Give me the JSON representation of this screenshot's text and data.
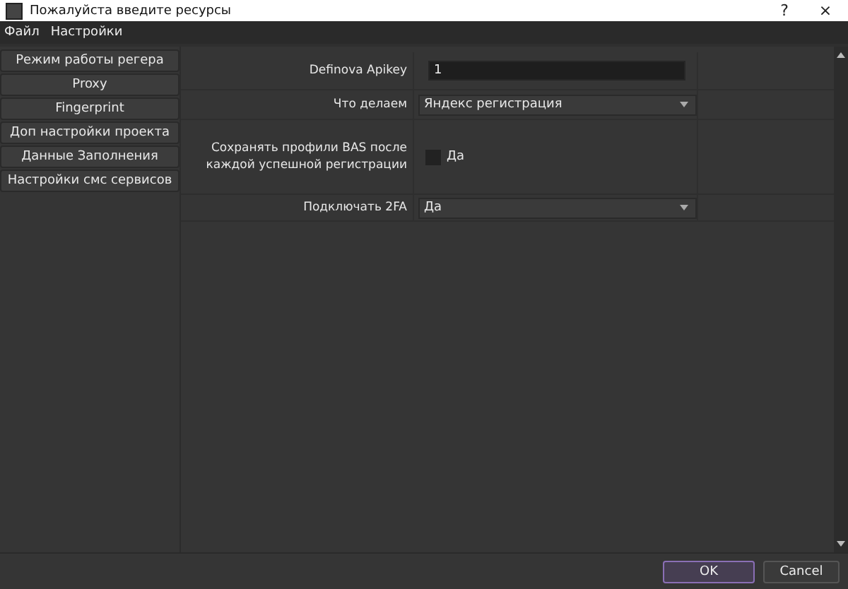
{
  "window": {
    "title": "Пожалуйста введите ресурсы",
    "help": "?",
    "close": "×"
  },
  "menu": [
    "Файл",
    "Настройки"
  ],
  "sidebar": {
    "items": [
      "Режим работы регера",
      "Proxy",
      "Fingerprint",
      "Доп настройки проекта",
      "Данные Заполнения",
      "Настройки смс сервисов"
    ]
  },
  "form": [
    {
      "kind": "text",
      "label": "Definova Apikey",
      "value": "1"
    },
    {
      "kind": "select",
      "label": "Что делаем",
      "value": "Яндекс регистрация"
    },
    {
      "kind": "checkbox",
      "label": "Сохранять профили BAS после каждой успешной регистрации",
      "option": "Да",
      "checked": false
    },
    {
      "kind": "select",
      "label": "Подключать 2FA",
      "value": "Да"
    }
  ],
  "buttons": [
    {
      "label": "OK",
      "default": true
    },
    {
      "label": "Cancel",
      "default": false
    }
  ]
}
